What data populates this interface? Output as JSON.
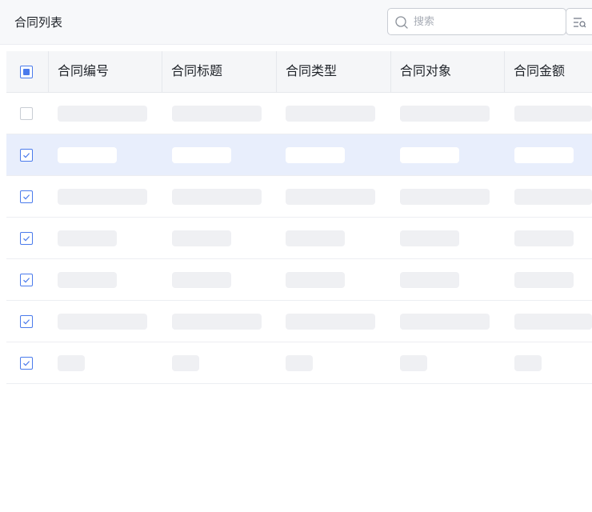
{
  "header": {
    "title": "合同列表",
    "search": {
      "placeholder": "搜索",
      "value": ""
    },
    "icons": {
      "search": "search-icon",
      "filter": "filter-search-icon"
    }
  },
  "table": {
    "columns": [
      {
        "key": "contract_no",
        "label": "合同编号"
      },
      {
        "key": "contract_title",
        "label": "合同标题"
      },
      {
        "key": "contract_type",
        "label": "合同类型"
      },
      {
        "key": "contract_party",
        "label": "合同对象"
      },
      {
        "key": "contract_amount",
        "label": "合同金额"
      }
    ],
    "select_all_state": "indeterminate",
    "rows": [
      {
        "checked": false,
        "highlighted": false,
        "loading": true
      },
      {
        "checked": true,
        "highlighted": true,
        "loading": true
      },
      {
        "checked": true,
        "highlighted": false,
        "loading": true
      },
      {
        "checked": true,
        "highlighted": false,
        "loading": true
      },
      {
        "checked": true,
        "highlighted": false,
        "loading": true
      },
      {
        "checked": true,
        "highlighted": false,
        "loading": true
      },
      {
        "checked": true,
        "highlighted": false,
        "loading": true
      }
    ]
  },
  "colors": {
    "accent": "#4b7bec",
    "header_bg": "#f7f8fa",
    "selected_row_bg": "#e8eefc",
    "skeleton": "#eff0f3"
  }
}
